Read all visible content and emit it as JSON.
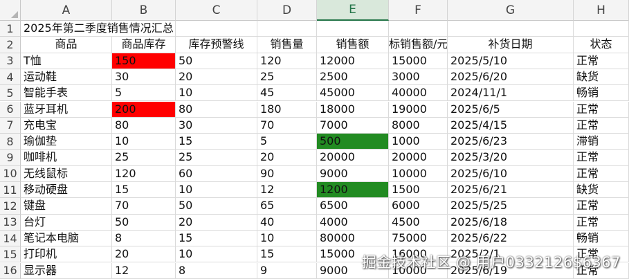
{
  "spreadsheet": {
    "selected_column": "E",
    "columns": [
      "A",
      "B",
      "C",
      "D",
      "E",
      "F",
      "G",
      "H"
    ],
    "row_numbers": [
      "1",
      "2",
      "3",
      "4",
      "5",
      "6",
      "7",
      "8",
      "9",
      "10",
      "11",
      "12",
      "13",
      "14",
      "15",
      "16"
    ],
    "title": "2025年第二季度销售情况汇总",
    "headers": [
      "商品",
      "商品库存",
      "库存预警线",
      "销售量",
      "销售额",
      "标销售额/元",
      "补货日期",
      "状态"
    ],
    "rows": [
      [
        "T恤",
        "150",
        "50",
        "120",
        "12000",
        "15000",
        "2025/5/10",
        "正常"
      ],
      [
        "运动鞋",
        "30",
        "20",
        "25",
        "2500",
        "3000",
        "2025/6/20",
        "缺货"
      ],
      [
        "智能手表",
        "5",
        "10",
        "45",
        "45000",
        "40000",
        "2024/11/1",
        "畅销"
      ],
      [
        "蓝牙耳机",
        "200",
        "80",
        "180",
        "18000",
        "19000",
        "2025/6/5",
        "正常"
      ],
      [
        "充电宝",
        "80",
        "30",
        "70",
        "7000",
        "8000",
        "2025/4/15",
        "正常"
      ],
      [
        "瑜伽垫",
        "10",
        "15",
        "5",
        "500",
        "1000",
        "2025/6/23",
        "滞销"
      ],
      [
        "咖啡机",
        "25",
        "25",
        "20",
        "20000",
        "20000",
        "2025/3/20",
        "正常"
      ],
      [
        "无线鼠标",
        "120",
        "60",
        "90",
        "9000",
        "10000",
        "2025/6/10",
        "正常"
      ],
      [
        "移动硬盘",
        "15",
        "10",
        "12",
        "1200",
        "1500",
        "2025/6/21",
        "缺货"
      ],
      [
        "键盘",
        "70",
        "50",
        "65",
        "6500",
        "6000",
        "2025/5/25",
        "正常"
      ],
      [
        "台灯",
        "50",
        "20",
        "40",
        "4000",
        "4500",
        "2025/6/18",
        "正常"
      ],
      [
        "笔记本电脑",
        "8",
        "15",
        "10",
        "80000",
        "75000",
        "2025/6/22",
        "畅销"
      ],
      [
        "打印机",
        "20",
        "10",
        "15",
        "15000",
        "16000",
        "2025/2/1",
        "正常"
      ],
      [
        "显示器",
        "12",
        "8",
        "9",
        "9000",
        "10000",
        "2025/6/19",
        "正常"
      ]
    ],
    "highlights": {
      "red_color": "#ff0000",
      "green_color": "#228b22",
      "red_cells": [
        [
          0,
          1
        ],
        [
          3,
          1
        ]
      ],
      "green_cells": [
        [
          5,
          4
        ],
        [
          8,
          4
        ]
      ]
    }
  },
  "watermark": "掘金技术社区 @ 用户0332126$6367"
}
